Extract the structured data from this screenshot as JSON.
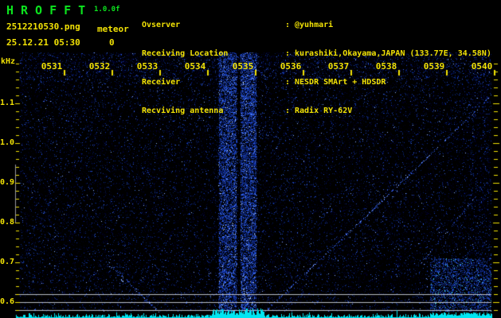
{
  "header": {
    "app_title": "HROFFT",
    "app_version": "1.0.0f",
    "filename": "2512210530.png",
    "mode_label": "meteor",
    "echo_count": "0",
    "datetime": "25.12.21 05:30",
    "station_rows": [
      {
        "label": "Ovserver",
        "value": "@yuhmari"
      },
      {
        "label": "Receiving Location",
        "value": "kurashiki,Okayama,JAPAN (133.77E, 34.58N)"
      },
      {
        "label": "Receiver",
        "value": "NESDR SMArt + HDSDR"
      },
      {
        "label": "Recviving antenna",
        "value": "Radix RY-62V"
      }
    ]
  },
  "chart_data": {
    "type": "heatmap",
    "subtype": "radio-meteor-spectrogram-waterfall",
    "title": "",
    "xlabel": "",
    "ylabel": "kHz",
    "x_tick_labels": [
      "0531",
      "0532",
      "0533",
      "0534",
      "0535",
      "0536",
      "0537",
      "0538",
      "0539",
      "0540"
    ],
    "x_minutes_span": 10,
    "y_tick_labels": [
      "1.1",
      "1.0",
      "0.9",
      "0.8",
      "0.7",
      "0.6"
    ],
    "y_ticks_khz": [
      1.1,
      1.0,
      0.9,
      0.8,
      0.7,
      0.6
    ],
    "y_minor_step_khz": 0.02,
    "ylim_khz": [
      0.576,
      1.228
    ],
    "reference_lines_khz": [
      0.62,
      0.6,
      0.58
    ],
    "axis_marker_khz": [
      0.8,
      0.946
    ],
    "meteor_echo_count": 0,
    "features": {
      "interference_bands": [
        {
          "u0": 0.422,
          "u1": 0.46,
          "note": "bright vertical noise band just before 0535"
        },
        {
          "u0": 0.468,
          "u1": 0.502,
          "note": "bright vertical noise band just after 0535"
        }
      ],
      "doppler_traces": [
        {
          "points_uv": [
            [
              0.52,
              1.0
            ],
            [
              0.684,
              0.718
            ],
            [
              0.853,
              0.426
            ],
            [
              0.995,
              0.175
            ]
          ],
          "intensity": "bright"
        },
        {
          "points_uv": [
            [
              0.85,
              0.816
            ],
            [
              1.0,
              0.482
            ]
          ],
          "intensity": "faint"
        },
        {
          "points_uv": [
            [
              0.199,
              0.831
            ],
            [
              0.294,
              1.0
            ]
          ],
          "intensity": "bright"
        },
        {
          "points_uv": [
            [
              0.182,
              0.807
            ],
            [
              0.231,
              0.908
            ]
          ],
          "intensity": "faint"
        }
      ],
      "noise_floor_plot": {
        "position": "bottom-strip",
        "elevated_regions_u": [
          [
            0.41,
            0.52
          ],
          [
            0.87,
            1.0
          ]
        ]
      }
    }
  },
  "colors": {
    "background": "#000000",
    "title_green": "#0ce41e",
    "label_yellow": "#f2e205",
    "noise_floor_cyan": "#00e6f2",
    "reference_line_gray": "#c3c7cf",
    "speckle_bright_blue": "#3a66e8"
  }
}
